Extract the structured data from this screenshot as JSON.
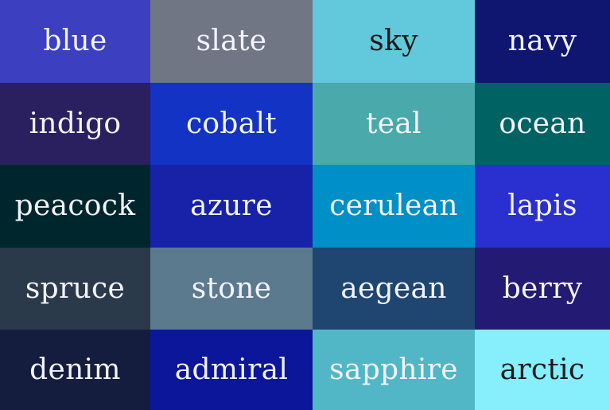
{
  "palette": [
    {
      "label": "blue",
      "color": "#3b3fc0",
      "text_color": "#f3f3ff"
    },
    {
      "label": "slate",
      "color": "#707683",
      "text_color": "#f3f3ff"
    },
    {
      "label": "sky",
      "color": "#62c8dc",
      "text_color": "#1a1a1a"
    },
    {
      "label": "navy",
      "color": "#0e166f",
      "text_color": "#f3f3ff"
    },
    {
      "label": "indigo",
      "color": "#2a1f5f",
      "text_color": "#f3f3ff"
    },
    {
      "label": "cobalt",
      "color": "#1233c4",
      "text_color": "#f3f3ff"
    },
    {
      "label": "teal",
      "color": "#49a9ab",
      "text_color": "#f3f3ff"
    },
    {
      "label": "ocean",
      "color": "#006262",
      "text_color": "#f3f3ff"
    },
    {
      "label": "peacock",
      "color": "#00262d",
      "text_color": "#f3f3ff"
    },
    {
      "label": "azure",
      "color": "#1722a9",
      "text_color": "#f3f3ff"
    },
    {
      "label": "cerulean",
      "color": "#008fc6",
      "text_color": "#f3f3ff"
    },
    {
      "label": "lapis",
      "color": "#2a2fd0",
      "text_color": "#f3f3ff"
    },
    {
      "label": "spruce",
      "color": "#2a3a4a",
      "text_color": "#f3f3ff"
    },
    {
      "label": "stone",
      "color": "#5c7a8e",
      "text_color": "#f3f3ff"
    },
    {
      "label": "aegean",
      "color": "#1e4670",
      "text_color": "#f3f3ff"
    },
    {
      "label": "berry",
      "color": "#231b73",
      "text_color": "#f3f3ff"
    },
    {
      "label": "denim",
      "color": "#141d3d",
      "text_color": "#f3f3ff"
    },
    {
      "label": "admiral",
      "color": "#0b169b",
      "text_color": "#f3f3ff"
    },
    {
      "label": "sapphire",
      "color": "#51b6c5",
      "text_color": "#f3f3ff"
    },
    {
      "label": "arctic",
      "color": "#87eefc",
      "text_color": "#1a1a1a"
    }
  ]
}
